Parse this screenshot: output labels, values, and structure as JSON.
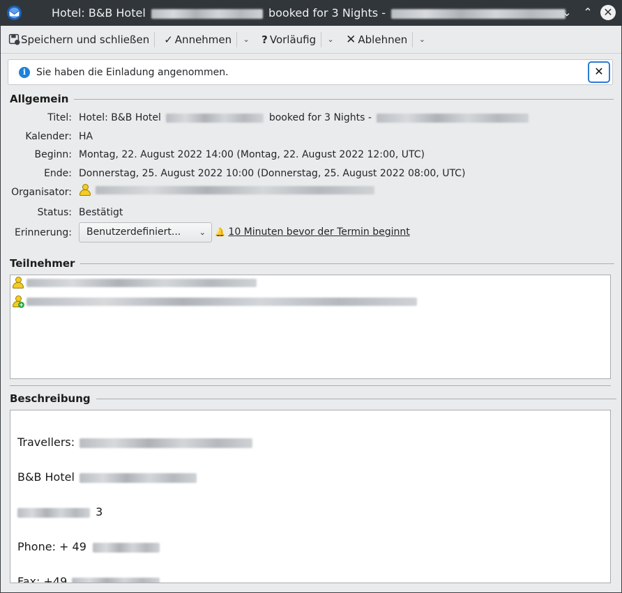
{
  "window": {
    "title_prefix": "Hotel: B&B Hotel",
    "title_mid": "booked for 3 Nights -",
    "minimize_symbol": "⌄",
    "maximize_symbol": "⌃",
    "close_symbol": "✕"
  },
  "toolbar": {
    "save_close": "Speichern und schließen",
    "accept": "Annehmen",
    "tentative": "Vorläufig",
    "decline": "Ablehnen",
    "accept_icon": "checkmark-icon",
    "tentative_icon": "question-icon",
    "decline_icon": "x-icon"
  },
  "notice": {
    "text": "Sie haben die Einladung angenommen.",
    "icon": "i",
    "close": "✕"
  },
  "general": {
    "heading": "Allgemein",
    "title_label": "Titel:",
    "title_prefix": "Hotel: B&B Hotel",
    "title_mid": "booked for 3 Nights -",
    "calendar_label": "Kalender:",
    "calendar_value": "HA",
    "start_label": "Beginn:",
    "start_value": "Montag, 22. August 2022 14:00 (Montag, 22. August 2022 12:00, UTC)",
    "end_label": "Ende:",
    "end_value": "Donnerstag, 25. August 2022 10:00 (Donnerstag, 25. August 2022 08:00, UTC)",
    "organizer_label": "Organisator:",
    "status_label": "Status:",
    "status_value": "Bestätigt",
    "reminder_label": "Erinnerung:",
    "reminder_select": "Benutzerdefiniert...",
    "reminder_text": "10 Minuten bevor der Termin beginnt"
  },
  "attendees": {
    "heading": "Teilnehmer"
  },
  "description": {
    "heading": "Beschreibung",
    "travellers": "Travellers:",
    "hotel": "B&B Hotel",
    "street_number": "3",
    "phone": "Phone: + 49",
    "fax": "Fax: +49"
  },
  "colors": {
    "titlebar": "#31363b",
    "window_bg": "#eaebec",
    "accent": "#2a7ad5",
    "info": "#1d82d8"
  }
}
